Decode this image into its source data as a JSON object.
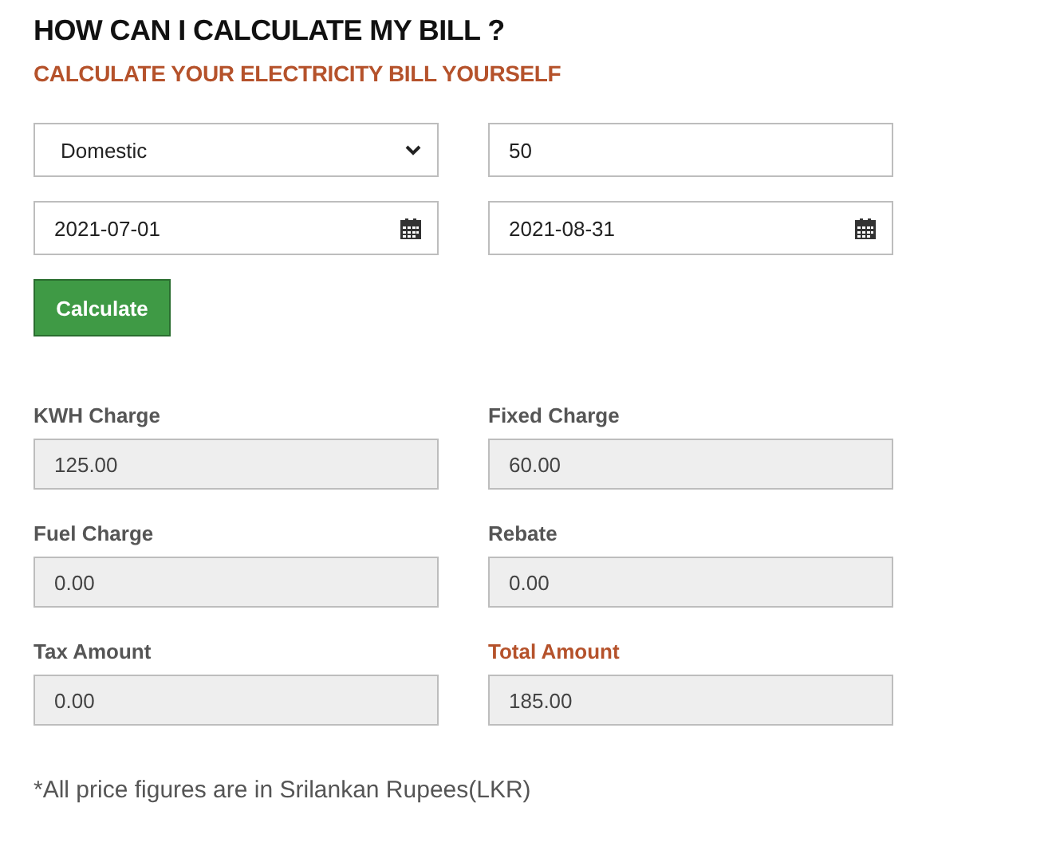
{
  "heading": "HOW CAN I CALCULATE MY BILL ?",
  "subheading": "CALCULATE YOUR ELECTRICITY BILL YOURSELF",
  "form": {
    "tariff": "Domestic",
    "units": "50",
    "start_date": "2021-07-01",
    "end_date": "2021-08-31",
    "button": "Calculate"
  },
  "results": [
    {
      "label": "KWH Charge",
      "value": "125.00",
      "emphasis": false
    },
    {
      "label": "Fixed Charge",
      "value": "60.00",
      "emphasis": false
    },
    {
      "label": "Fuel Charge",
      "value": "0.00",
      "emphasis": false
    },
    {
      "label": "Rebate",
      "value": "0.00",
      "emphasis": false
    },
    {
      "label": "Tax Amount",
      "value": "0.00",
      "emphasis": false
    },
    {
      "label": "Total Amount",
      "value": "185.00",
      "emphasis": true
    }
  ],
  "footnote": "*All price figures are in Srilankan Rupees(LKR)"
}
